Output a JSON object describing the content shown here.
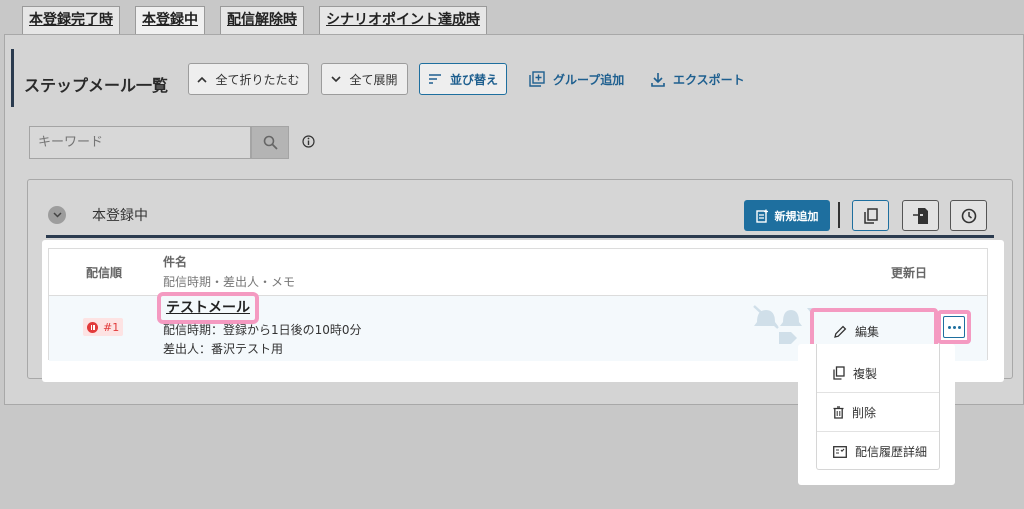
{
  "tabs": [
    "本登録完了時",
    "本登録中",
    "配信解除時",
    "シナリオポイント達成時"
  ],
  "page_title": "ステップメール一覧",
  "toolbar": {
    "collapse_all": "全て折りたたむ",
    "expand_all": "全て展開",
    "sort": "並び替え",
    "add_group": "グループ追加",
    "export": "エクスポート"
  },
  "search": {
    "placeholder": "キーワード"
  },
  "group": {
    "name": "本登録中",
    "add_new": "新規追加"
  },
  "table": {
    "col_order": "配信順",
    "col_subject": "件名",
    "col_subject_sub": "配信時期・差出人・メモ",
    "col_updated": "更新日",
    "rows": [
      {
        "order": "#1",
        "subject": "テストメール",
        "timing": "配信時期：登録から1日後の10時0分",
        "sender": "差出人：番沢テスト用"
      }
    ]
  },
  "menu": {
    "edit": "編集",
    "copy": "複製",
    "delete": "削除",
    "history": "配信履歴詳細"
  },
  "colors": {
    "accent": "#1e6f9f",
    "highlight": "#f49ac1",
    "stopped": "#e23a3a"
  }
}
